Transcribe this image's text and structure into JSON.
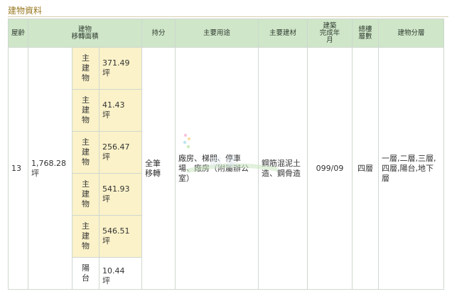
{
  "section": {
    "title": "建物資料"
  },
  "table": {
    "headers": {
      "age": "屋齡",
      "area": "建物\n移轉面積",
      "ownership": "持分",
      "usage": "主要用途",
      "material": "主要建材",
      "completion": "建築\n完成年\n月",
      "floors": "總樓\n層數",
      "levels": "建物分層"
    },
    "row": {
      "age": "13",
      "total_area": "1,768.28\n坪",
      "ownership": "全筆\n移轉",
      "usage": "廠房、梯間、停車\n場、廠房（附屬辦公\n室）",
      "material": "鋼筋混泥土\n造、鋼骨造",
      "completion": "099/09",
      "floors": "四層",
      "levels": "一層,二層,三層,\n四層,陽台,地下\n層"
    },
    "sub_items": [
      {
        "type": "主\n建\n物",
        "area": "371.49\n坪"
      },
      {
        "type": "主\n建\n物",
        "area": "41.43\n坪"
      },
      {
        "type": "主\n建\n物",
        "area": "256.47\n坪"
      },
      {
        "type": "主\n建\n物",
        "area": "541.93\n坪"
      },
      {
        "type": "主\n建\n物",
        "area": "546.51\n坪"
      },
      {
        "type": "陽\n台",
        "area": "10.44\n坪"
      }
    ]
  },
  "colors": {
    "header_bg": "#cfe6c9",
    "highlight_bg": "#fbf2c9",
    "title_color": "#9a7a24",
    "border": "#cfd8cf"
  }
}
